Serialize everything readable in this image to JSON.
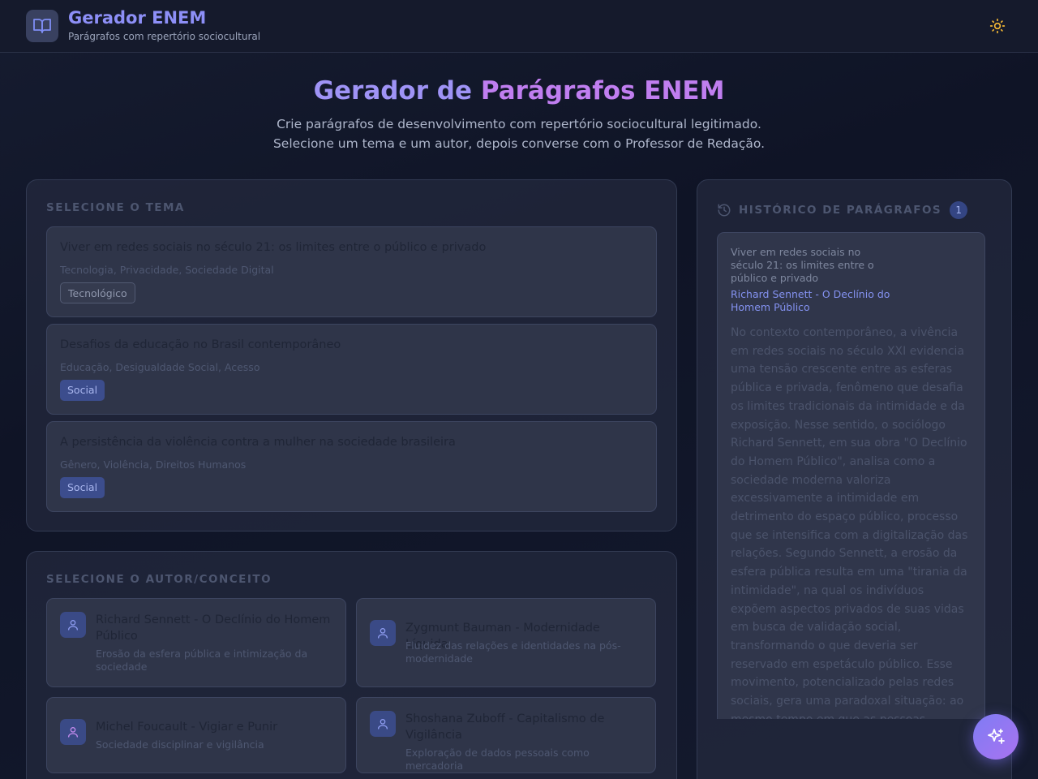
{
  "header": {
    "title": "Gerador ENEM",
    "subtitle": "Parágrafos com repertório sociocultural",
    "logo_icon": "open-book-icon",
    "theme_icon": "sun-icon"
  },
  "hero": {
    "title_part1": "Gerador de",
    "title_part2": "Parágrafos ENEM",
    "description_line1": "Crie parágrafos de desenvolvimento com repertório sociocultural legitimado.",
    "description_line2": "Selecione um tema e um autor, depois converse com o Professor de Redação."
  },
  "themes": {
    "section_title": "SELECIONE O TEMA",
    "items": [
      {
        "title": "Viver em redes sociais no século 21: os limites entre o público e privado",
        "tags": "Tecnologia, Privacidade, Sociedade Digital",
        "badge": "Tecnológico"
      },
      {
        "title": "Desafios da educação no Brasil contemporâneo",
        "tags": "Educação, Desigualdade Social, Acesso",
        "badge": "Social"
      },
      {
        "title": "A persistência da violência contra a mulher na sociedade brasileira",
        "tags": "Gênero, Violência, Direitos Humanos",
        "badge": "Social"
      }
    ]
  },
  "authors": {
    "section_title": "SELECIONE O AUTOR/CONCEITO",
    "items": [
      {
        "name": "Richard Sennett - O Declínio do Homem Público",
        "description": "Erosão da esfera pública e intimização da sociedade",
        "icon": "user-icon"
      },
      {
        "name": "Zygmunt Bauman - Modernidade Líquida",
        "description": "Fluidez das relações e identidades na pós-modernidade",
        "icon": "user-icon"
      },
      {
        "name": "Michel Foucault - Vigiar e Punir",
        "description": "Sociedade disciplinar e vigilância",
        "icon": "user-icon"
      },
      {
        "name": "Shoshana Zuboff - Capitalismo de Vigilância",
        "description": "Exploração de dados pessoais como mercadoria",
        "icon": "user-icon"
      }
    ]
  },
  "history": {
    "section_title": "HISTÓRICO DE PARÁGRAFOS",
    "count": "1",
    "icon": "history-icon",
    "entries": [
      {
        "theme": "Viver em redes sociais no século 21: os limites entre o público e privado",
        "author": "Richard Sennett - O Declínio do Homem Público",
        "text": "No contexto contemporâneo, a vivência em redes sociais no século XXI evidencia uma tensão crescente entre as esferas pública e privada, fenômeno que desafia os limites tradicionais da intimidade e da exposição. Nesse sentido, o sociólogo Richard Sennett, em sua obra \"O Declínio do Homem Público\", analisa como a sociedade moderna valoriza excessivamente a intimidade em detrimento do espaço público, processo que se intensifica com a digitalização das relações. Segundo Sennett, a erosão da esfera pública resulta em uma \"tirania da intimidade\", na qual os indivíduos expõem aspectos privados de suas vidas em busca de validação social, transformando o que deveria ser reservado em espetáculo público. Esse movimento, potencializado pelas redes sociais, gera uma paradoxal situação: ao mesmo tempo em que as pessoas"
      }
    ]
  },
  "fab": {
    "icon": "sparkles-icon"
  }
}
